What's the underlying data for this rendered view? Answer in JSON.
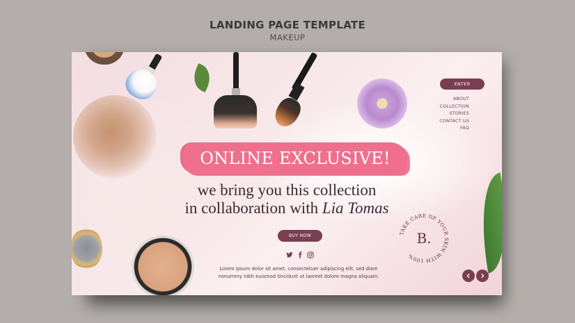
{
  "header": {
    "title": "LANDING PAGE TEMPLATE",
    "subtitle": "MAKEUP"
  },
  "landing": {
    "enter_label": "ENTER",
    "nav": [
      "ABOUT",
      "COLLECTION",
      "STORIES",
      "CONTACT US",
      "FAQ"
    ],
    "headline": "ONLINE EXCLUSIVE!",
    "tagline_line1": "we bring you this collection",
    "tagline_line2_prefix": "in collaboration with ",
    "tagline_name": "Lia Tomas",
    "buy_label": "BUY NOW",
    "social_icons": [
      "twitter-icon",
      "facebook-icon",
      "instagram-icon"
    ],
    "body_line1": "Lorem ipsum dolor sit amet, consectetuer adipiscing elit, sed diam",
    "body_line2": "nonummy nibh euismod tincidunt ut laoreet dolore magna aliquam.",
    "badge_letter": "B.",
    "badge_ring_text": "TAKE CARE OF YOUR SKIN WITH 100%",
    "arrow_icons": [
      "chevron-left-icon",
      "chevron-right-icon"
    ]
  },
  "colors": {
    "page_bg": "#b3aeab",
    "accent": "#7a3e53",
    "brushstroke": "#ee6f8e",
    "headline_text": "#ffffff",
    "tagline_text": "#3a2a36"
  }
}
